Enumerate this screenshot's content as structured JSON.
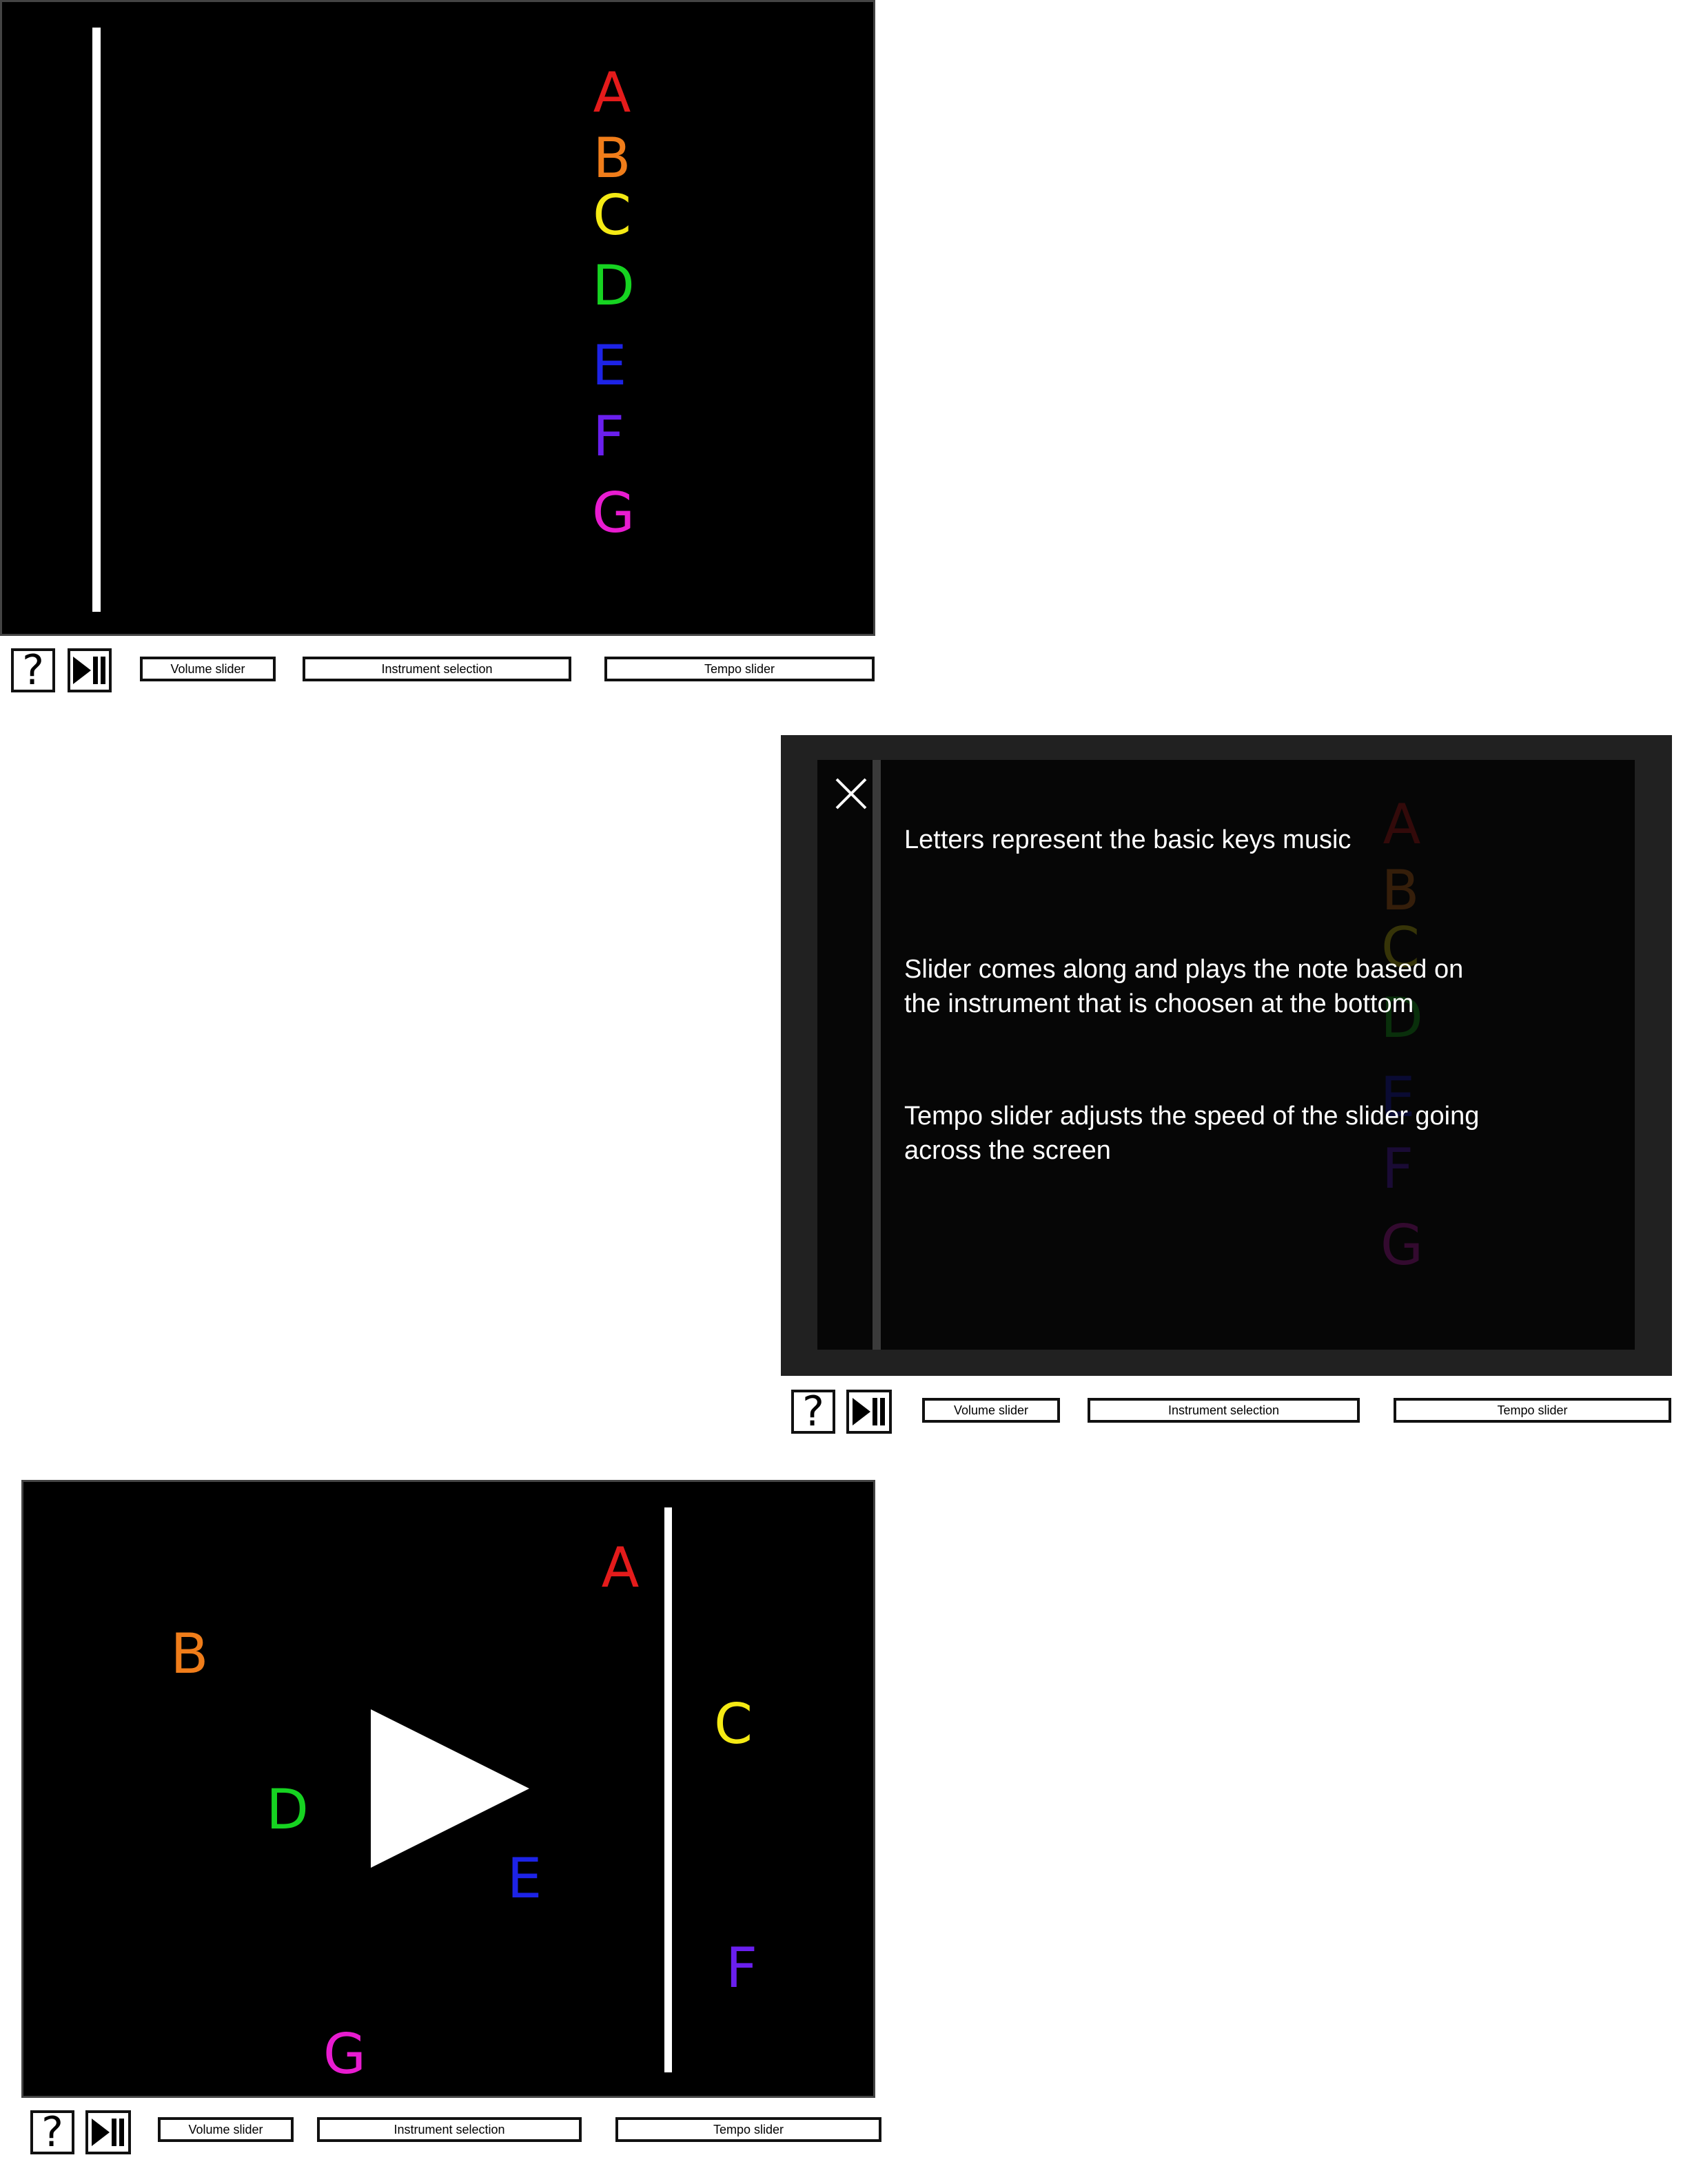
{
  "toolbar": {
    "help_icon": "question-mark-icon",
    "play_pause_icon": "play-pause-icon",
    "volume_label": "Volume slider",
    "instrument_label": "Instrument selection",
    "tempo_label": "Tempo slider"
  },
  "notes": [
    {
      "letter": "A",
      "color": "#e41b1b"
    },
    {
      "letter": "B",
      "color": "#f07d1a"
    },
    {
      "letter": "C",
      "color": "#f5ea14"
    },
    {
      "letter": "D",
      "color": "#16d321"
    },
    {
      "letter": "E",
      "color": "#1d23e6"
    },
    {
      "letter": "F",
      "color": "#6a1fee"
    },
    {
      "letter": "G",
      "color": "#e81cd0"
    }
  ],
  "help_dialog": {
    "close_icon": "close-icon",
    "line1": "Letters represent the basic keys music",
    "line2": "Slider comes along and plays the note based on\nthe instrument that is choosen at the bottom",
    "line3": "Tempo slider adjusts the speed of the slider going\nacross the screen"
  },
  "play_overlay": {
    "icon": "play-icon"
  }
}
